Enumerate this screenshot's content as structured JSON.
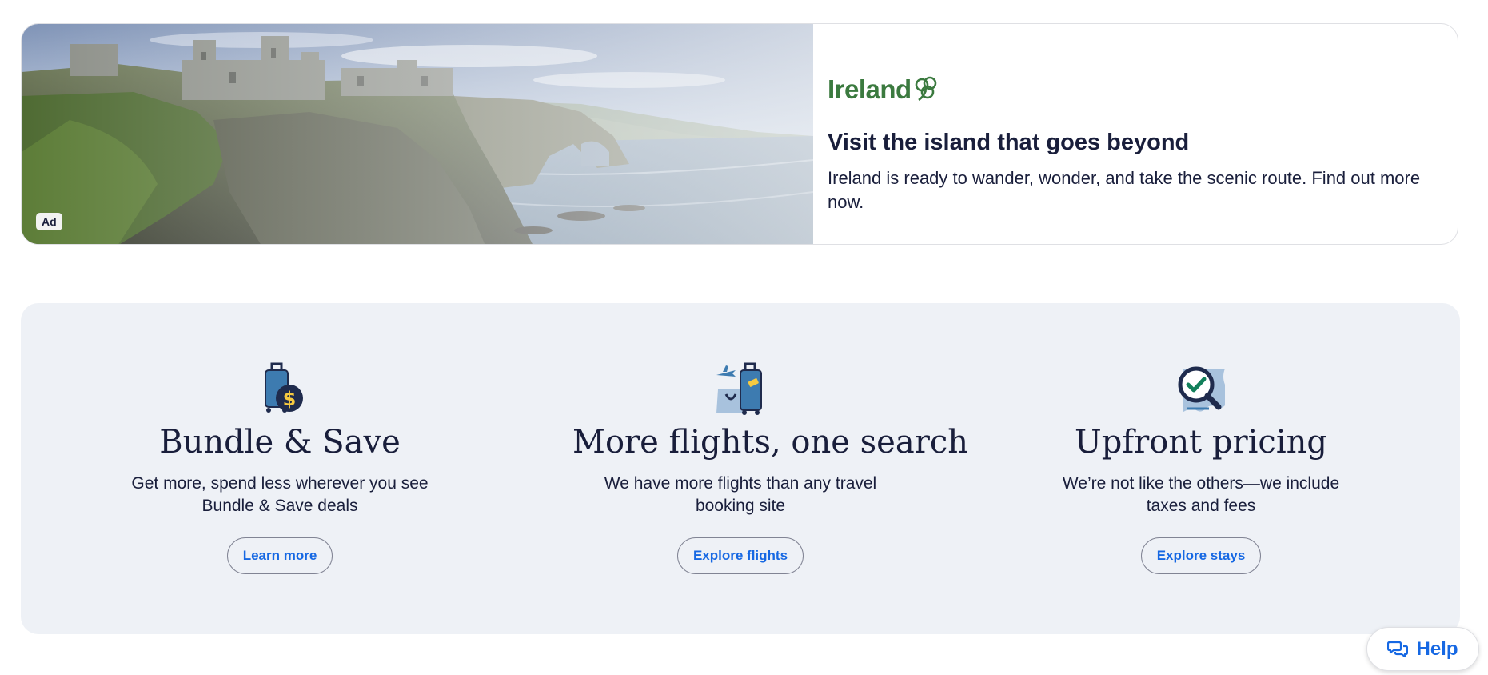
{
  "ad": {
    "badge": "Ad",
    "brand": "Ireland",
    "headline": "Visit the island that goes beyond",
    "body": "Ireland is ready to wander, wonder, and take the scenic route. Find out more now.",
    "image_icon": "coastal-castle-ruins-photo",
    "brand_color": "#3b7a3f"
  },
  "features": [
    {
      "icon": "suitcase-dollar-icon",
      "title": "Bundle & Save",
      "description": "Get more, spend less wherever you see Bundle & Save deals",
      "button": "Learn more"
    },
    {
      "icon": "plane-luggage-icon",
      "title": "More flights, one search",
      "description": "We have more flights than any travel booking site",
      "button": "Explore flights"
    },
    {
      "icon": "magnifier-check-receipt-icon",
      "title": "Upfront pricing",
      "description": "We’re not like the others—we include taxes and fees",
      "button": "Explore stays"
    }
  ],
  "help": {
    "label": "Help",
    "icon": "chat-bubbles-icon"
  },
  "colors": {
    "accent": "#1668e3",
    "text": "#191e3b",
    "panel_bg": "#eef1f6",
    "icon_navy": "#1f2b4d",
    "icon_blue": "#3d7bb0",
    "icon_yellow": "#f6c940",
    "check_green": "#12805b"
  }
}
